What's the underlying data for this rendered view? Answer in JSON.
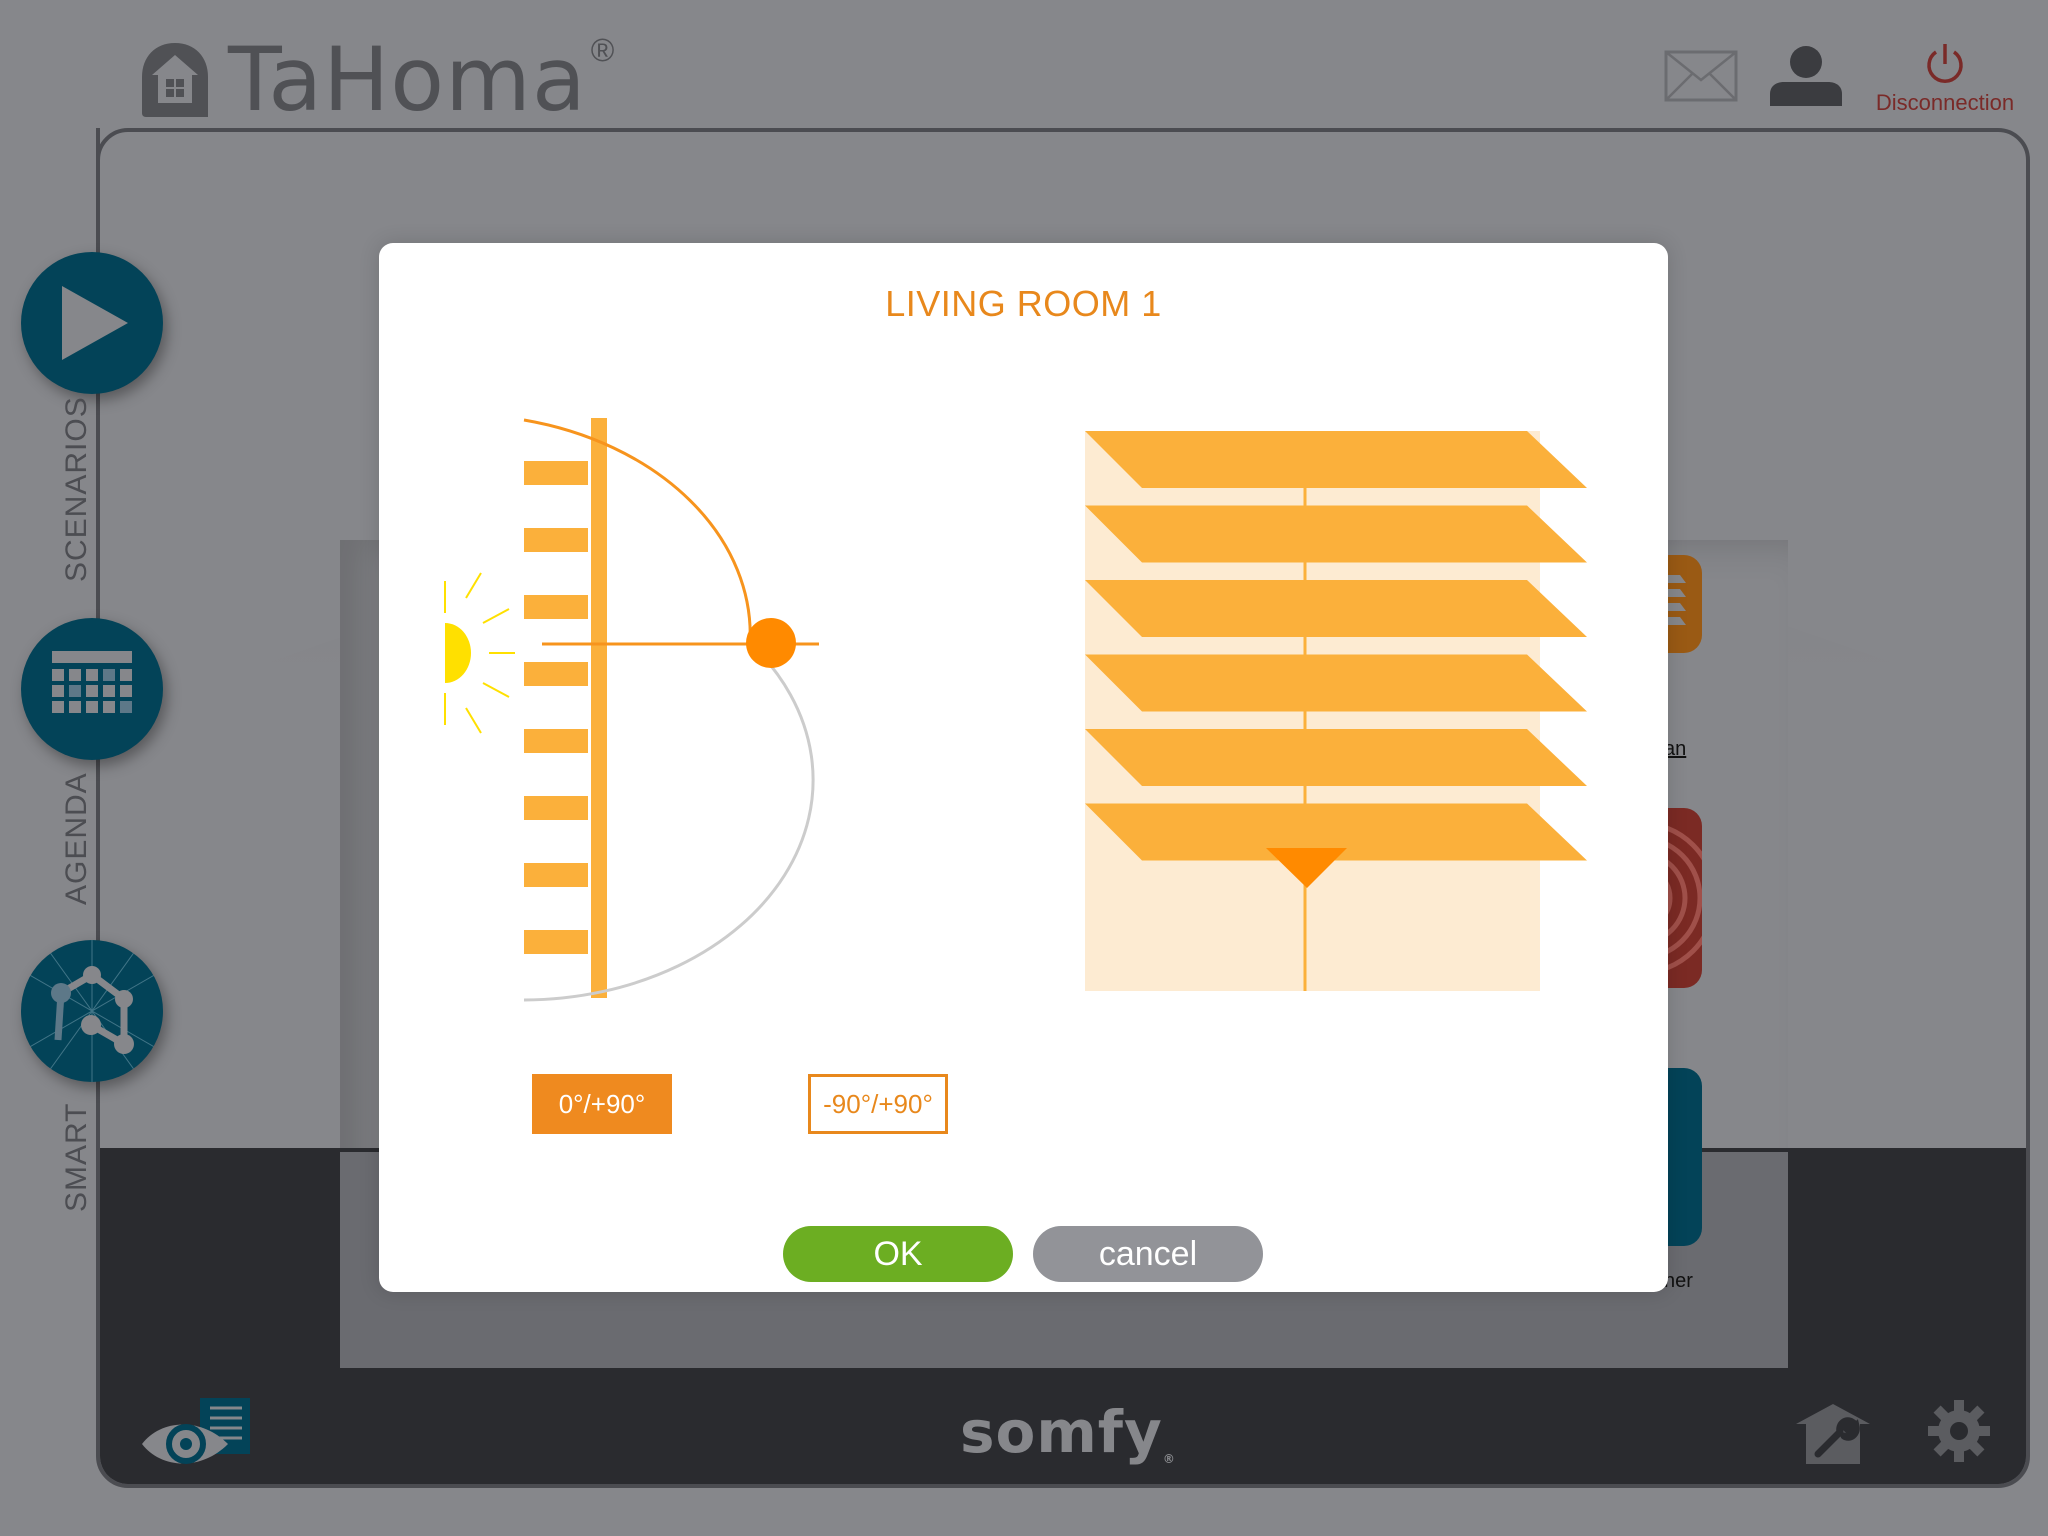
{
  "header": {
    "app_name": "TaHoma",
    "registered_mark": "®",
    "icons": [
      "home-logo-icon",
      "mail-icon",
      "user-icon",
      "power-icon"
    ],
    "disconnect_label": "Disconnection"
  },
  "sidebar": {
    "items": [
      {
        "label": "SCENARIOS",
        "icon": "play-icon"
      },
      {
        "label": "AGENDA",
        "icon": "calendar-icon"
      },
      {
        "label": "SMART",
        "icon": "network-icon"
      }
    ]
  },
  "background": {
    "tile_captions": [
      "an",
      "ner"
    ]
  },
  "footer": {
    "brand": "somfy",
    "brand_mark": "®",
    "icons": [
      "eye-document-icon",
      "house-wrench-icon",
      "gear-icon"
    ]
  },
  "modal": {
    "title": "LIVING ROOM 1",
    "modes": [
      {
        "label": "0°/+90°",
        "selected": true
      },
      {
        "label": "-90°/+90°",
        "selected": false
      }
    ],
    "slat_angle_deg": 0,
    "ok_label": "OK",
    "cancel_label": "cancel",
    "colors": {
      "accent": "#e8881c",
      "slat": "#fbb03b",
      "handle": "#ff8a00",
      "sun": "#ffe000",
      "ok": "#6cae22",
      "cancel": "#929398"
    }
  }
}
